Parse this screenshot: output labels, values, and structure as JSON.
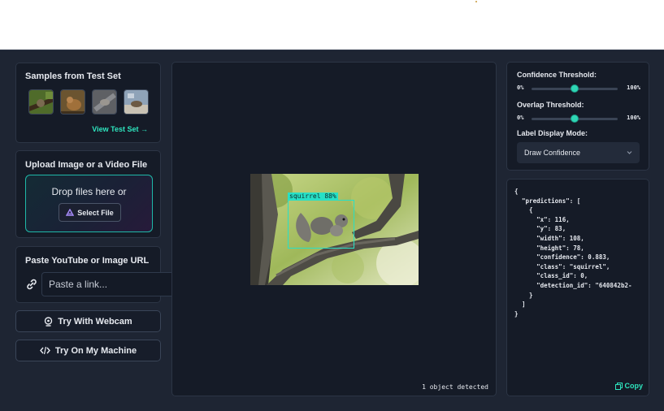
{
  "samples": {
    "title": "Samples from Test Set",
    "view_link": "View Test Set →"
  },
  "upload": {
    "title": "Upload Image or a Video File",
    "drop_text": "Drop files here or",
    "select_button": "Select File"
  },
  "paste": {
    "title": "Paste YouTube or Image URL",
    "placeholder": "Paste a link..."
  },
  "buttons": {
    "webcam": "Try With Webcam",
    "machine": "Try On My Machine"
  },
  "viewer": {
    "bbox_label": "squirrel 88%",
    "status": "1 object detected"
  },
  "settings": {
    "confidence_label": "Confidence Threshold:",
    "overlap_label": "Overlap Threshold:",
    "min": "0%",
    "max": "100%",
    "confidence_value": 0.5,
    "overlap_value": 0.5,
    "label_mode_label": "Label Display Mode:",
    "label_mode_value": "Draw Confidence"
  },
  "json_output": {
    "text": "{\n  \"predictions\": [\n    {\n      \"x\": 116,\n      \"y\": 83,\n      \"width\": 108,\n      \"height\": 78,\n      \"confidence\": 0.883,\n      \"class\": \"squirrel\",\n      \"class_id\": 0,\n      \"detection_id\": \"640842b2-\n    }\n  ]\n}",
    "copy_label": "Copy"
  },
  "colors": {
    "accent": "#2ee6bf",
    "background": "#1e2533",
    "panel": "#151b27"
  }
}
